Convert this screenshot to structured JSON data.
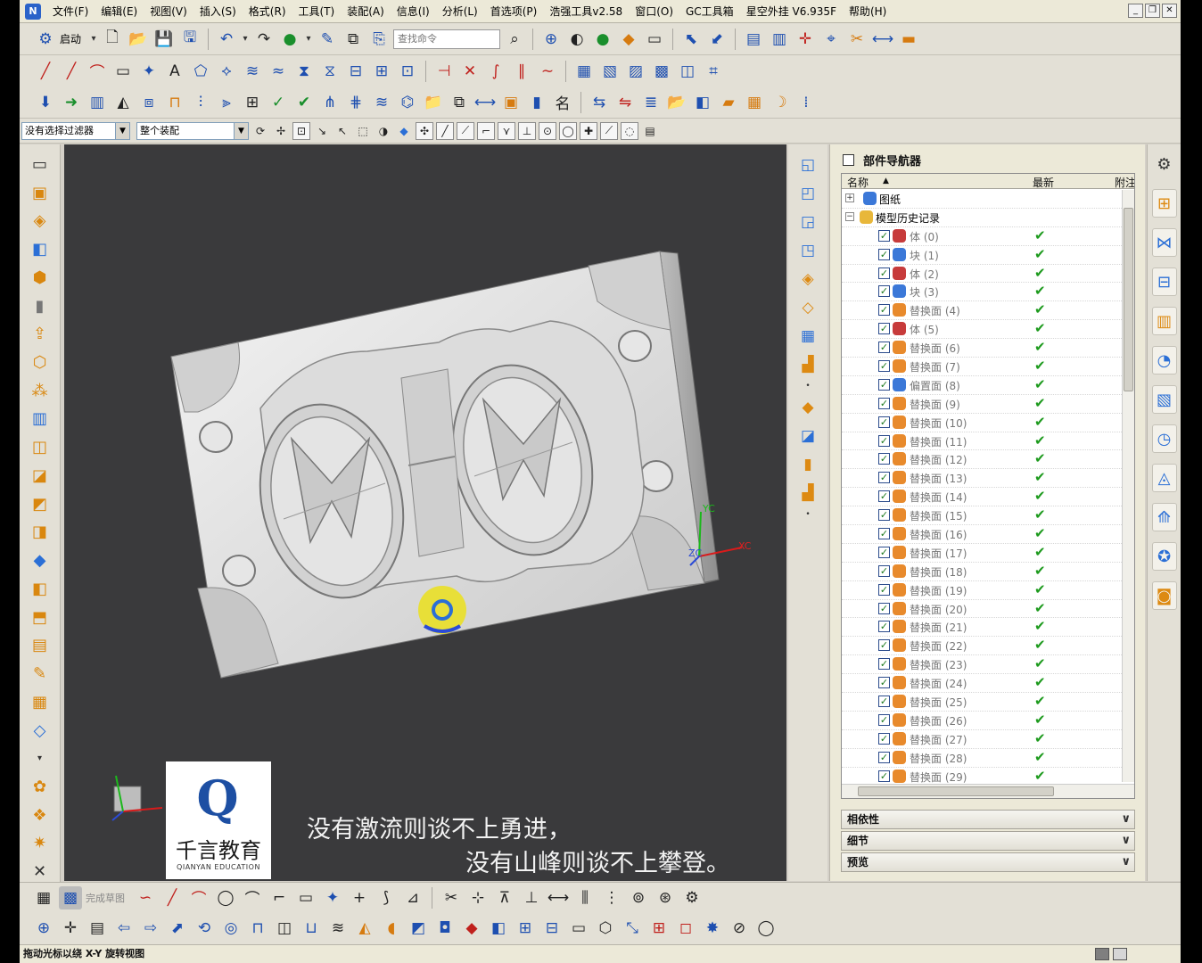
{
  "menubar": {
    "items": [
      "文件(F)",
      "编辑(E)",
      "视图(V)",
      "插入(S)",
      "格式(R)",
      "工具(T)",
      "装配(A)",
      "信息(I)",
      "分析(L)",
      "首选项(P)",
      "浩强工具v2.58",
      "窗口(O)",
      "GC工具箱",
      "星空外挂 V6.935F",
      "帮助(H)"
    ]
  },
  "toolbar": {
    "start_label": "启动",
    "search_placeholder": "查找命令"
  },
  "selection": {
    "filter_value": "没有选择过滤器",
    "scope_value": "整个装配"
  },
  "viewport": {
    "subtitle_line1": "没有激流则谈不上勇进，",
    "subtitle_line2": "没有山峰则谈不上攀登。",
    "axis_xc": "XC",
    "axis_zc": "ZC",
    "axis_yc": "YC",
    "logo_cn": "千言教育",
    "logo_en": "QIANYAN EDUCATION"
  },
  "navigator": {
    "title": "部件导航器",
    "col_name": "名称",
    "col_latest": "最新",
    "col_note": "附注",
    "root_drawing": "图纸",
    "root_history": "模型历史记录",
    "features": [
      {
        "label": "体 (0)",
        "icon": "body"
      },
      {
        "label": "块 (1)",
        "icon": "block"
      },
      {
        "label": "体 (2)",
        "icon": "body"
      },
      {
        "label": "块 (3)",
        "icon": "block"
      },
      {
        "label": "替换面 (4)",
        "icon": "face"
      },
      {
        "label": "体 (5)",
        "icon": "body"
      },
      {
        "label": "替换面 (6)",
        "icon": "face"
      },
      {
        "label": "替换面 (7)",
        "icon": "face"
      },
      {
        "label": "偏置面 (8)",
        "icon": "offset"
      },
      {
        "label": "替换面 (9)",
        "icon": "face"
      },
      {
        "label": "替换面 (10)",
        "icon": "face"
      },
      {
        "label": "替换面 (11)",
        "icon": "face"
      },
      {
        "label": "替换面 (12)",
        "icon": "face"
      },
      {
        "label": "替换面 (13)",
        "icon": "face"
      },
      {
        "label": "替换面 (14)",
        "icon": "face"
      },
      {
        "label": "替换面 (15)",
        "icon": "face"
      },
      {
        "label": "替换面 (16)",
        "icon": "face"
      },
      {
        "label": "替换面 (17)",
        "icon": "face"
      },
      {
        "label": "替换面 (18)",
        "icon": "face"
      },
      {
        "label": "替换面 (19)",
        "icon": "face"
      },
      {
        "label": "替换面 (20)",
        "icon": "face"
      },
      {
        "label": "替换面 (21)",
        "icon": "face"
      },
      {
        "label": "替换面 (22)",
        "icon": "face"
      },
      {
        "label": "替换面 (23)",
        "icon": "face"
      },
      {
        "label": "替换面 (24)",
        "icon": "face"
      },
      {
        "label": "替换面 (25)",
        "icon": "face"
      },
      {
        "label": "替换面 (26)",
        "icon": "face"
      },
      {
        "label": "替换面 (27)",
        "icon": "face"
      },
      {
        "label": "替换面 (28)",
        "icon": "face"
      },
      {
        "label": "替换面 (29)",
        "icon": "face"
      }
    ],
    "sections": [
      "相依性",
      "细节",
      "预览"
    ]
  },
  "bottom": {
    "sketch_label": "完成草图"
  },
  "status": {
    "text": "拖动光标以绕 X-Y 旋转视图"
  },
  "colors": {
    "viewport_bg": "#3a3a3c",
    "panel_bg": "#ece9d8",
    "check_green": "#1d9a1d",
    "accent_blue": "#2b6fd6",
    "icon_orange": "#dd8a12"
  }
}
